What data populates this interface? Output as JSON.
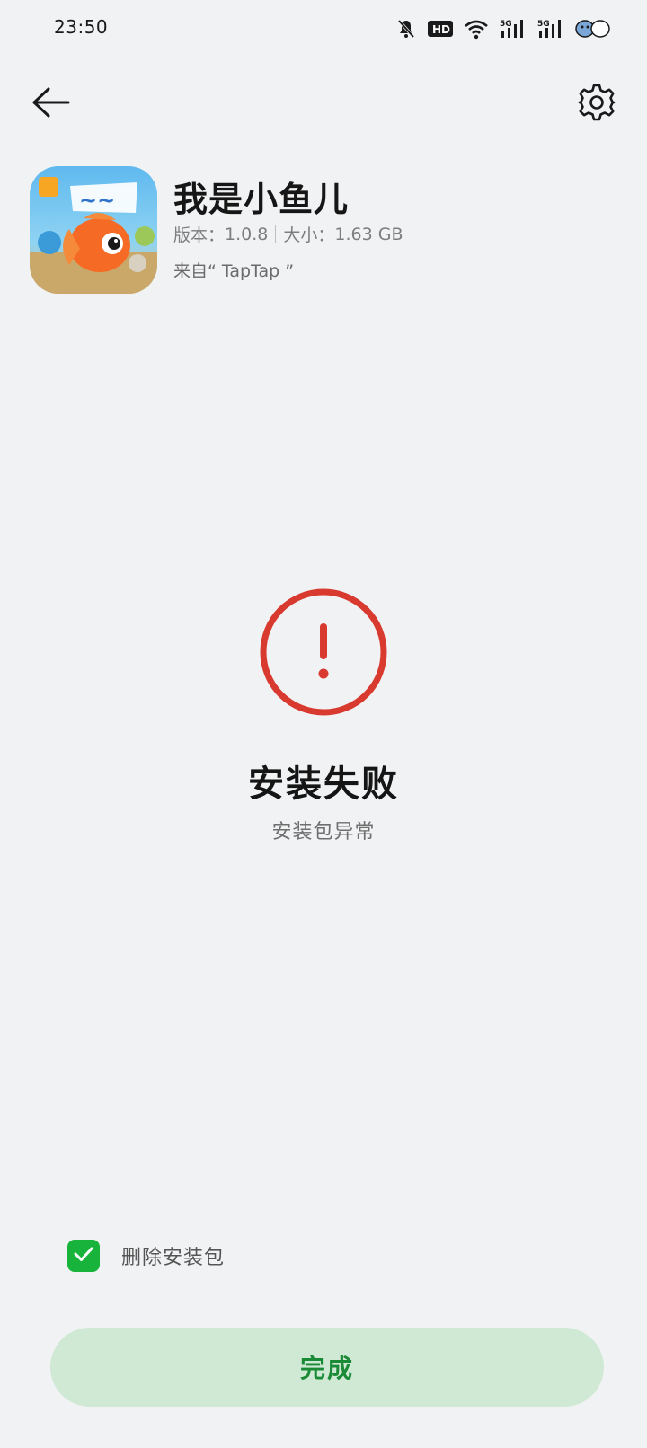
{
  "status_bar": {
    "time": "23:50",
    "icons": [
      "mute-bell-icon",
      "hd-icon",
      "wifi-icon",
      "5g-signal-icon",
      "5g-signal-icon",
      "battery-icon"
    ],
    "hd_label": "HD",
    "net_label_1": "5G",
    "net_label_2": "5G"
  },
  "header": {
    "back_icon": "back-arrow-icon",
    "settings_icon": "gear-icon"
  },
  "app": {
    "name": "我是小鱼儿",
    "version_label": "版本：",
    "version": "1.0.8",
    "size_label": "大小：",
    "size": "1.63 GB",
    "source": "来自“ TapTap ”"
  },
  "result": {
    "icon": "error-exclamation-icon",
    "title": "安装失败",
    "subtitle": "安装包异常",
    "accent_color": "#d93a2f"
  },
  "delete_option": {
    "label": "删除安装包",
    "checked": true,
    "color": "#17b33a"
  },
  "done_button": {
    "label": "完成",
    "background": "#cfe9d4",
    "text_color": "#1b8a36"
  }
}
